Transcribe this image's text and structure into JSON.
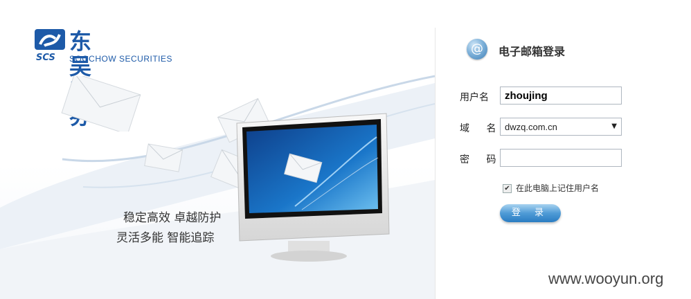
{
  "brand": {
    "name_cn": "东吴证券",
    "name_en": "SOOCHOW SECURITIES",
    "mark_text": "SCS"
  },
  "slogans": [
    "稳定高效  卓越防护",
    "灵活多能  智能追踪"
  ],
  "login": {
    "title": "电子邮箱登录",
    "icon": "at-icon",
    "username_label": "用户名",
    "username_value": "zhoujing",
    "domain_label": "域  名",
    "domain_value": "dwzq.com.cn",
    "password_label": "密  码",
    "password_value": "",
    "remember_label": "在此电脑上记住用户名",
    "remember_checked": true,
    "submit_label": "登 录"
  },
  "watermark": "www.wooyun.org",
  "colors": {
    "brand": "#1d5aa8",
    "button": "#4f9bd6"
  }
}
